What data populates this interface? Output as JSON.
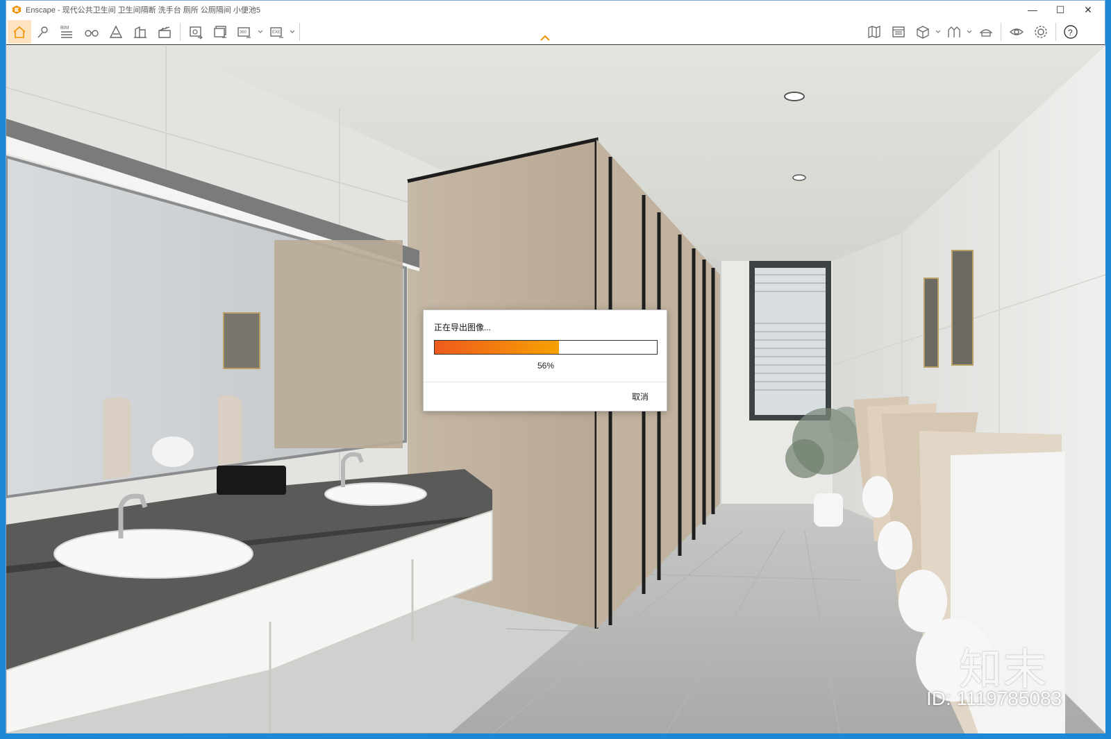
{
  "window": {
    "title": "Enscape - 现代公共卫生间 卫生间隔断 洗手台 厕所 公厕隔间 小便池5",
    "minimize_symbol": "—",
    "maximize_symbol": "☐",
    "close_symbol": "✕"
  },
  "toolbar": {
    "left_icons": [
      "home-icon",
      "location-pin-icon",
      "bim-icon",
      "binoculars-icon",
      "mountain-icon",
      "building-icon",
      "clapper-icon",
      "screenshot-icon",
      "batch-render-icon",
      "panorama-360-icon",
      "export-exe-icon"
    ],
    "right_icons": [
      "map-icon",
      "asset-library-icon",
      "material-cube-icon",
      "visual-settings-icon",
      "hat-icon",
      "eye-icon",
      "gear-icon",
      "help-icon"
    ],
    "collapse_icon": "chevron-up-icon",
    "accent": "#f29100"
  },
  "dialog": {
    "title": "正在导出图像...",
    "progress": 0.56,
    "progress_text": "56%",
    "cancel_label": "取消",
    "fill_from": "#ee5a1e",
    "fill_to": "#f7a100"
  },
  "overlay": {
    "brand_mark": "知末",
    "brand_id": "ID: 1119785083"
  }
}
